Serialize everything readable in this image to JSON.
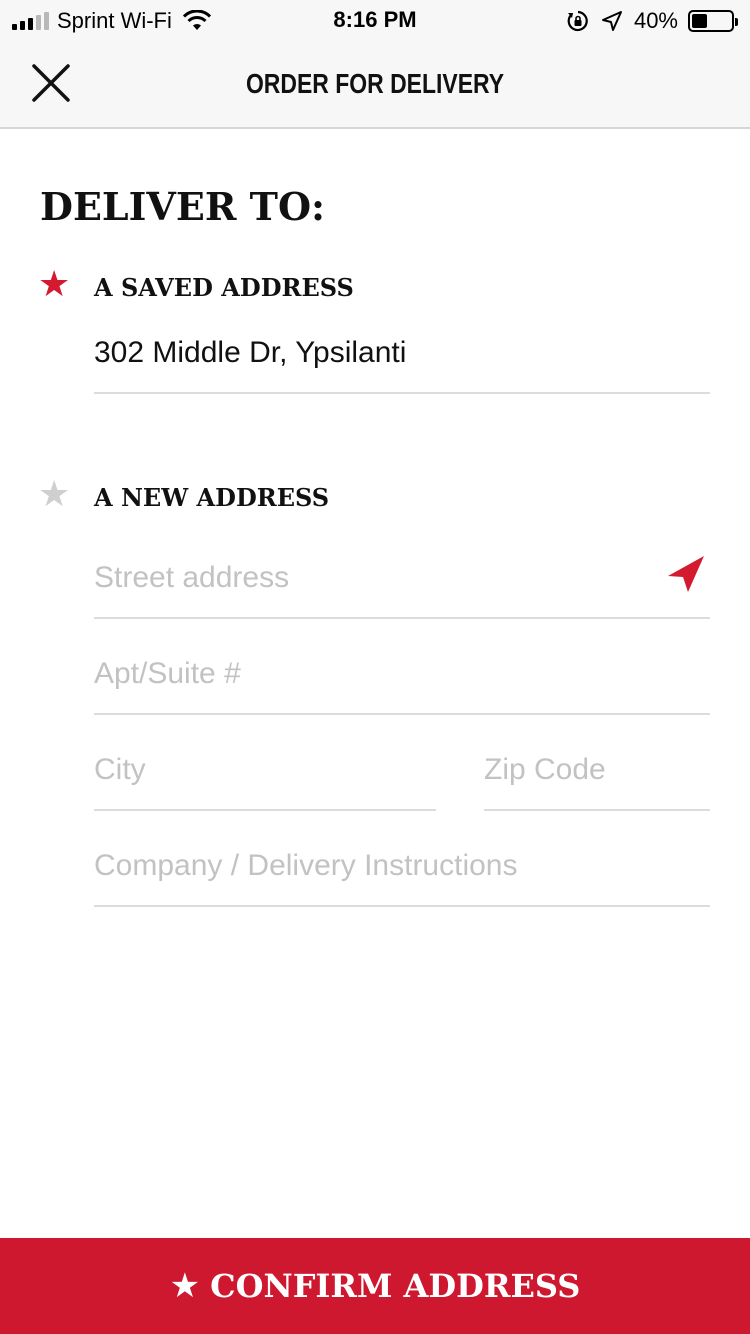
{
  "status_bar": {
    "carrier": "Sprint Wi-Fi",
    "time": "8:16 PM",
    "battery_percent": "40%",
    "battery_level": 0.4,
    "icons": [
      "signal-icon",
      "wifi-icon",
      "rotation-lock-icon",
      "location-icon",
      "battery-icon"
    ]
  },
  "nav": {
    "title": "ORDER FOR DELIVERY",
    "close_icon": "close-icon"
  },
  "heading": "DELIVER TO:",
  "saved_address": {
    "label": "A SAVED ADDRESS",
    "value": "302 Middle Dr, Ypsilanti",
    "selected": true
  },
  "new_address": {
    "label": "A NEW ADDRESS",
    "selected": false,
    "street_placeholder": "Street address",
    "apt_placeholder": "Apt/Suite #",
    "city_placeholder": "City",
    "zip_placeholder": "Zip Code",
    "instructions_placeholder": "Company / Delivery Instructions"
  },
  "confirm_button": {
    "label": "CONFIRM ADDRESS",
    "icon": "star-icon"
  },
  "colors": {
    "accent": "#ce1830",
    "star_selected": "#d41a2f",
    "star_unselected": "#cfcfcf",
    "placeholder": "#c2c2c2",
    "bar_background": "#f7f7f7"
  }
}
